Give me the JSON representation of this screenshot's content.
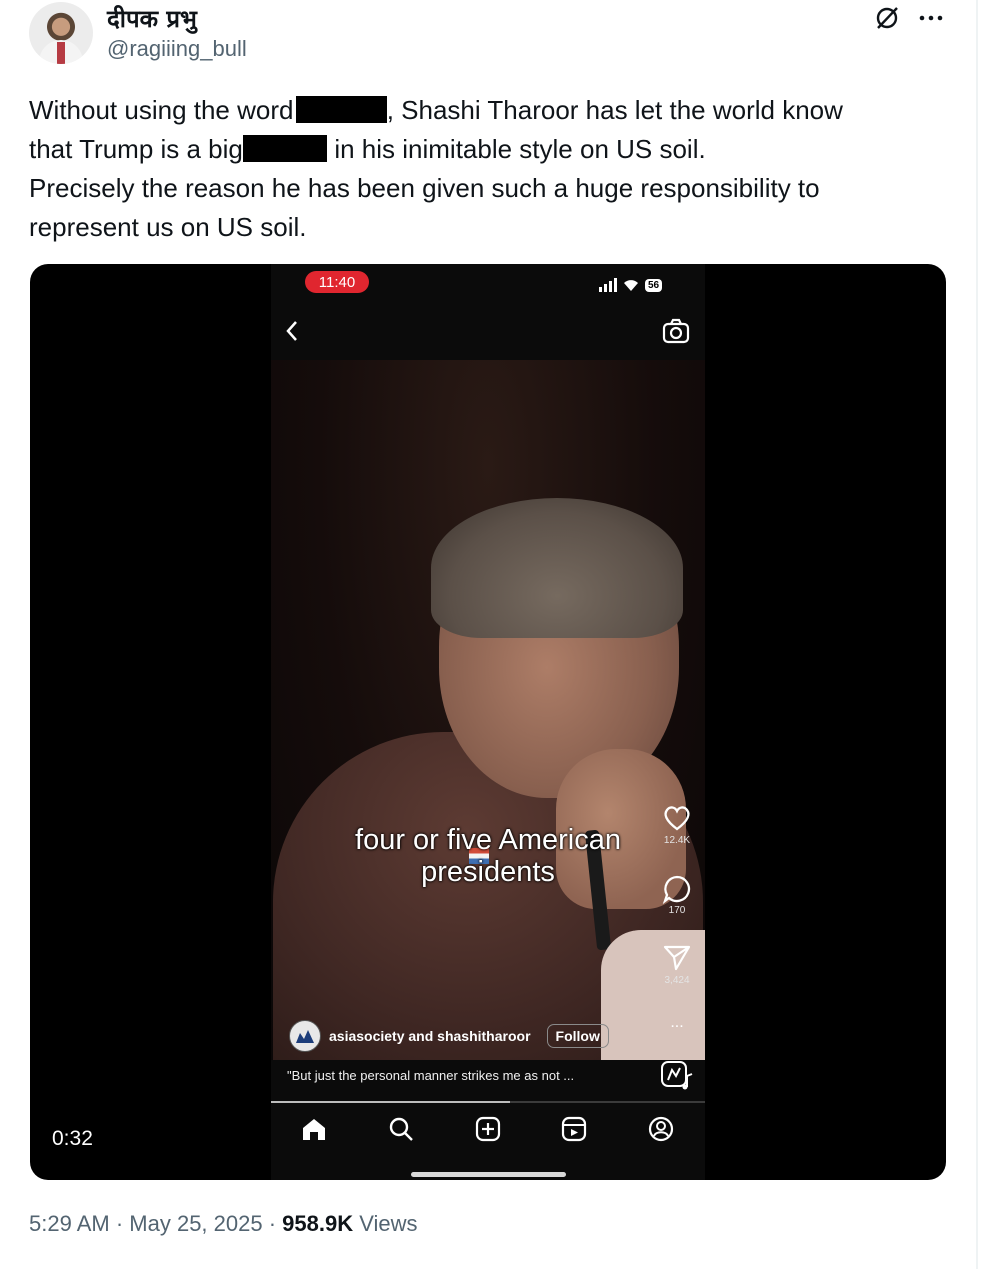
{
  "author": {
    "display_name": "दीपक प्रभु",
    "handle": "@ragiiing_bull"
  },
  "tweet": {
    "line1_a": "Without using the word ",
    "line1_b": ", Shashi Tharoor has let the world know",
    "line2_a": "that Trump is a big ",
    "line2_b": " in his inimitable style on US soil.",
    "line3": "Precisely the reason he has been given such a huge responsibility to",
    "line4": "represent us on US soil."
  },
  "media": {
    "status_time": "11:40",
    "battery": "56",
    "caption_line1": "four or five American",
    "caption_line2": "presidents",
    "likes": "12.4K",
    "comments": "170",
    "shares": "3,424",
    "more": "...",
    "post_author": "asiasociety and shashitharoor",
    "follow_label": "Follow",
    "post_caption": "\"But just the personal manner strikes me as not ...",
    "video_duration": "0:32"
  },
  "footer": {
    "time": "5:29 AM",
    "separator": " · ",
    "date": "May 25, 2025",
    "views_count": "958.9K",
    "views_label": " Views"
  },
  "icons": [
    "grok-icon",
    "more-icon",
    "back-icon",
    "camera-icon",
    "heart-icon",
    "comment-icon",
    "share-icon",
    "audio-icon",
    "home-icon",
    "search-icon",
    "create-icon",
    "reels-icon",
    "profile-icon"
  ]
}
